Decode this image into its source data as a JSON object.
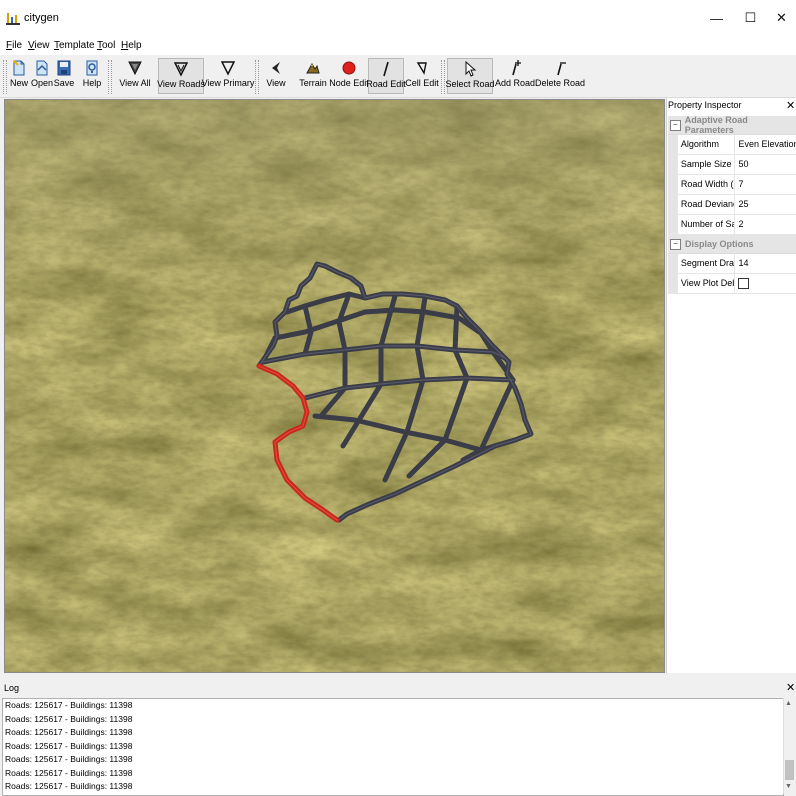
{
  "window": {
    "title": "citygen",
    "minimize": "—",
    "maximize": "☐",
    "close": "✕"
  },
  "menu": {
    "items": [
      {
        "label": "File",
        "u": "F",
        "rest": "ile"
      },
      {
        "label": "View",
        "u": "V",
        "rest": "iew"
      },
      {
        "label": "Template",
        "u": "T",
        "rest": "emplate"
      },
      {
        "label": "Tool",
        "u": "T",
        "rest": "ool"
      },
      {
        "label": "Help",
        "u": "H",
        "rest": "elp"
      }
    ]
  },
  "toolbar": {
    "new": "New",
    "open": "Open",
    "save": "Save",
    "help": "Help",
    "view_all": "View All",
    "view_roads": "View Roads",
    "view_primary": "View Primary",
    "view": "View",
    "terrain": "Terrain",
    "node_edit": "Node Edit",
    "road_edit": "Road Edit",
    "cell_edit": "Cell Edit",
    "select_road": "Select Road",
    "add_road": "Add Road",
    "delete_road": "Delete Road"
  },
  "inspector": {
    "title": "Property Inspector",
    "close": "✕",
    "groups": [
      {
        "label": "Adaptive Road Parameters",
        "toggle": "−",
        "rows": [
          {
            "name": "Algorithm",
            "value": "Even Elevation Dif"
          },
          {
            "name": "Sample Size (m)",
            "value": "50"
          },
          {
            "name": "Road Width (m)",
            "value": "7"
          },
          {
            "name": "Road Deviance",
            "value": "25"
          },
          {
            "name": "Number of Samples",
            "value": "2"
          }
        ]
      },
      {
        "label": "Display Options",
        "toggle": "−",
        "rows": [
          {
            "name": "Segment Draw Size",
            "value": "14"
          },
          {
            "name": "View Plot Debug",
            "value": ""
          }
        ]
      }
    ],
    "view_plot_debug_checked": false
  },
  "log": {
    "title": "Log",
    "close": "✕",
    "lines": [
      "Roads: 125617 - Buildings: 11398",
      "Roads: 125617 - Buildings: 11398",
      "Roads: 125617 - Buildings: 11398",
      "Roads: 125617 - Buildings: 11398",
      "Roads: 125617 - Buildings: 11398",
      "Roads: 125617 - Buildings: 11398",
      "Roads: 125617 - Buildings: 11398"
    ]
  },
  "colors": {
    "terrain_base": "#6b6228",
    "road": "#3a3c48",
    "road_highlight": "#606070",
    "selected_road": "#c8281c",
    "node_red": "#e0201a"
  }
}
